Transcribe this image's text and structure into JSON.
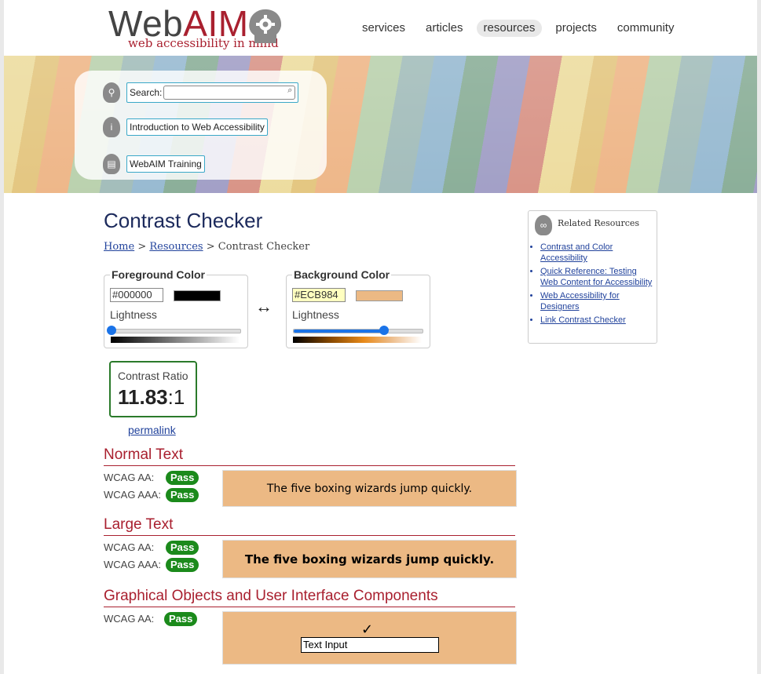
{
  "header": {
    "logo_word_prefix": "Web",
    "logo_word_suffix": "AIM",
    "logo_tagline": "web accessibility in mind",
    "nav": [
      {
        "label": "services",
        "active": false
      },
      {
        "label": "articles",
        "active": false
      },
      {
        "label": "resources",
        "active": true
      },
      {
        "label": "projects",
        "active": false
      },
      {
        "label": "community",
        "active": false
      }
    ]
  },
  "quick_links": {
    "search_label": "Search:",
    "search_value": "",
    "intro_label": "Introduction to Web Accessibility",
    "training_label": "WebAIM Training"
  },
  "page": {
    "title": "Contrast Checker",
    "breadcrumb": {
      "home": "Home",
      "sep1": " > ",
      "resources": "Resources",
      "sep2": " > ",
      "current": "Contrast Checker"
    }
  },
  "foreground": {
    "legend": "Foreground Color",
    "hex": "#000000",
    "color": "#000000",
    "lightness_label": "Lightness",
    "lightness": 0.0
  },
  "background": {
    "legend": "Background Color",
    "hex": "#ECB984",
    "color": "#ECB984",
    "lightness_label": "Lightness",
    "lightness": 0.7
  },
  "swap_symbol": "↔",
  "contrast": {
    "label": "Contrast Ratio",
    "value": "11.83",
    "suffix": ":1",
    "permalink": "permalink"
  },
  "sections": {
    "normal": {
      "heading": "Normal Text",
      "aa_label": "WCAG AA:",
      "aa": "Pass",
      "aaa_label": "WCAG AAA:",
      "aaa": "Pass",
      "sample": "The five boxing wizards jump quickly."
    },
    "large": {
      "heading": "Large Text",
      "aa_label": "WCAG AA:",
      "aa": "Pass",
      "aaa_label": "WCAG AAA:",
      "aaa": "Pass",
      "sample": "The five boxing wizards jump quickly."
    },
    "graphical": {
      "heading": "Graphical Objects and User Interface Components",
      "aa_label": "WCAG AA:",
      "aa": "Pass",
      "check": "✓",
      "input_text": "Text Input"
    }
  },
  "related": {
    "title": "Related Resources",
    "links": [
      "Contrast and Color Accessibility",
      "Quick Reference: Testing Web Content for Accessibility",
      "Web Accessibility for Designers",
      "Link Contrast Checker"
    ]
  },
  "colors": {
    "accent_red": "#a9202f",
    "pass_green": "#1b8a1b",
    "link_blue": "#22439c"
  }
}
